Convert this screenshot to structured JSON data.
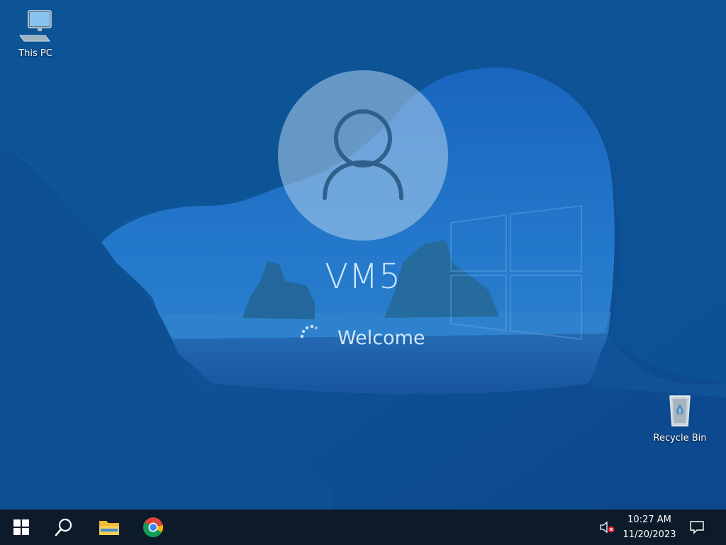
{
  "desktop": {
    "icons": [
      {
        "label": "This PC",
        "icon": "computer-icon"
      },
      {
        "label": "Recycle Bin",
        "icon": "recycle-bin-icon"
      }
    ]
  },
  "login": {
    "username": "VM5",
    "status": "Welcome"
  },
  "taskbar": {
    "apps": [
      "windows-start-icon",
      "search-icon",
      "file-explorer-icon",
      "chrome-icon"
    ],
    "tray": [
      "volume-muted-icon",
      "notification-icon"
    ],
    "time": "10:27 AM",
    "date": "11/20/2023"
  },
  "colors": {
    "wallpaper": "#0b3f7e",
    "taskbar": "#0d1a29",
    "text": "#cfe6fb"
  }
}
